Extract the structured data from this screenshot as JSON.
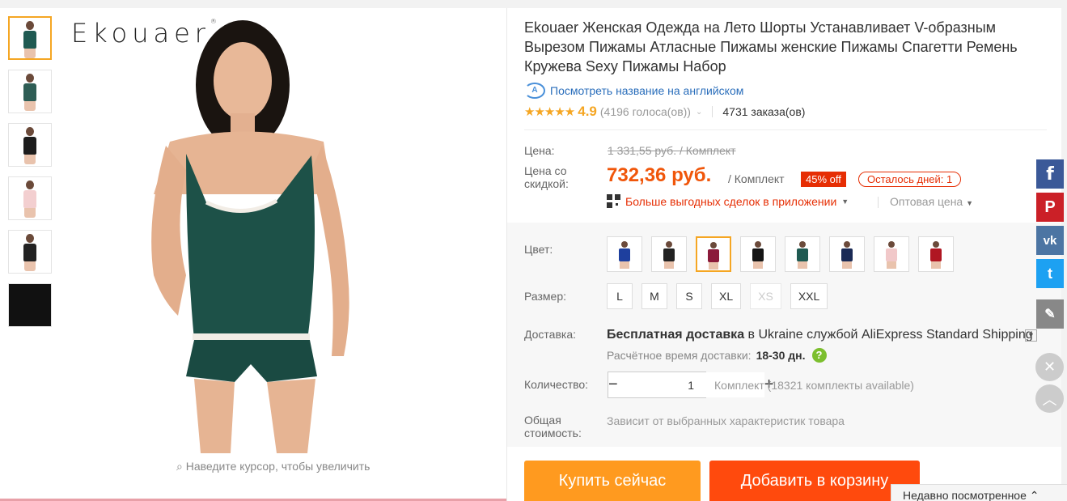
{
  "brand": {
    "logo_text": "Ekouaer",
    "reg_mark": "®"
  },
  "gallery": {
    "zoom_hint": "Наведите курсор, чтобы увеличить",
    "thumbnails": [
      {
        "color": "#1f5a52"
      },
      {
        "color": "#2e5d55"
      },
      {
        "color": "#1d1d1d"
      },
      {
        "color": "#f3cfd0"
      },
      {
        "color": "#222222"
      },
      {
        "color": "#111111"
      }
    ]
  },
  "product": {
    "title": "Ekouaer Женская Одежда на Лето Шорты Устанавливает V-образным Вырезом Пижамы Атласные Пижамы женские Пижамы Спагетти Ремень Кружева Sexy Пижамы Набор",
    "translate_link": "Посмотреть название на английском",
    "rating": "4.9",
    "stars": "★★★★★",
    "votes": "(4196 голоса(ов))",
    "orders": "4731 заказа(ов)"
  },
  "price": {
    "label": "Цена:",
    "old": "1 331,55 руб. / Комплект",
    "discount_label": "Цена со скидкой:",
    "new": "732,36 руб.",
    "unit": "/ Комплект",
    "discount_badge": "45% off",
    "days_left": "Осталось дней: 1",
    "app_deal": "Больше выгодных сделок в приложении",
    "wholesale": "Оптовая цена"
  },
  "options": {
    "color_label": "Цвет:",
    "colors": [
      {
        "name": "blue",
        "hex": "#1e3f9e"
      },
      {
        "name": "black-pattern",
        "hex": "#222222"
      },
      {
        "name": "wine",
        "hex": "#8b1a3a"
      },
      {
        "name": "black",
        "hex": "#151515"
      },
      {
        "name": "green",
        "hex": "#1f5a52"
      },
      {
        "name": "navy",
        "hex": "#1a2a55"
      },
      {
        "name": "pink",
        "hex": "#f1c8c9"
      },
      {
        "name": "red",
        "hex": "#b01622"
      }
    ],
    "selected_color_index": 2,
    "size_label": "Размер:",
    "sizes": [
      "L",
      "M",
      "S",
      "XL",
      "XS",
      "XXL"
    ]
  },
  "shipping": {
    "label": "Доставка:",
    "free_text": "Бесплатная доставка",
    "to_text": "в",
    "country": "Ukraine",
    "via_text": "службой",
    "service": "AliExpress Standard Shipping",
    "time_label": "Расчётное время доставки:",
    "time_value": "18-30 дн."
  },
  "quantity": {
    "label": "Количество:",
    "value": "1",
    "available": "Комплект (18321 комплекты available)"
  },
  "total": {
    "label": "Общая стоимость:",
    "value": "Зависит от выбранных характеристик товара"
  },
  "actions": {
    "buy_now": "Купить сейчас",
    "add_to_cart": "Добавить в корзину"
  },
  "social": {
    "facebook": "f",
    "pinterest": "P",
    "vk": "vk",
    "twitter": "t",
    "edit": "✎",
    "close": "✕",
    "up": "︿"
  },
  "recently_viewed": "Недавно посмотренное"
}
